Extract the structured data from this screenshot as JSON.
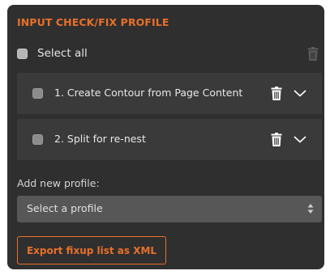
{
  "panel": {
    "title": "INPUT CHECK/FIX PROFILE",
    "select_all_label": "Select all",
    "profiles": [
      {
        "label": "1. Create Contour from Page Content"
      },
      {
        "label": "2. Split for re-nest"
      }
    ],
    "add_profile_label": "Add new profile:",
    "select_placeholder": "Select a profile",
    "export_button_label": "Export fixup list as XML"
  },
  "colors": {
    "accent": "#e8702a",
    "panel_background": "#2f2f2f",
    "row_background": "#3a3a3a",
    "select_background": "#575757"
  }
}
